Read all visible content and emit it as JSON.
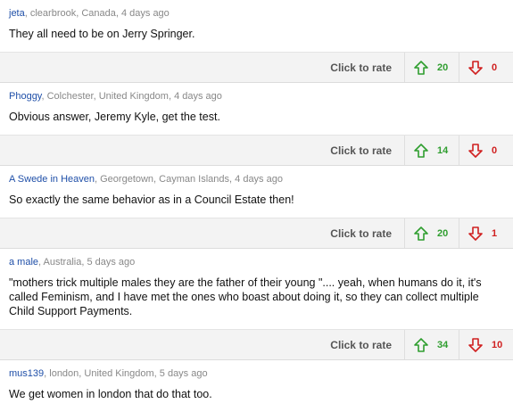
{
  "rate_label": "Click to rate",
  "colors": {
    "author_link": "#1f4fa8",
    "vote_up": "#2f9e2f",
    "vote_down": "#d02020"
  },
  "comments": [
    {
      "author": "jeta",
      "location": ", clearbrook, Canada, 4 days ago",
      "text": "They all need to be on Jerry Springer.",
      "up": "20",
      "down": "0"
    },
    {
      "author": "Phoggy",
      "location": ", Colchester, United Kingdom, 4 days ago",
      "text": "Obvious answer, Jeremy Kyle, get the test.",
      "up": "14",
      "down": "0"
    },
    {
      "author": "A Swede in Heaven",
      "location": ", Georgetown, Cayman Islands, 4 days ago",
      "text": "So exactly the same behavior as in a Council Estate then!",
      "up": "20",
      "down": "1"
    },
    {
      "author": "a male",
      "location": ", Australia, 5 days ago",
      "text": "\"mothers trick multiple males they are the father of their young \".... yeah, when humans do it, it's called Feminism, and I have met the ones who boast about doing it, so they can collect multiple Child Support Payments.",
      "up": "34",
      "down": "10"
    },
    {
      "author": "mus139",
      "location": ", london, United Kingdom, 5 days ago",
      "text": "We get women in london that do that too."
    }
  ]
}
